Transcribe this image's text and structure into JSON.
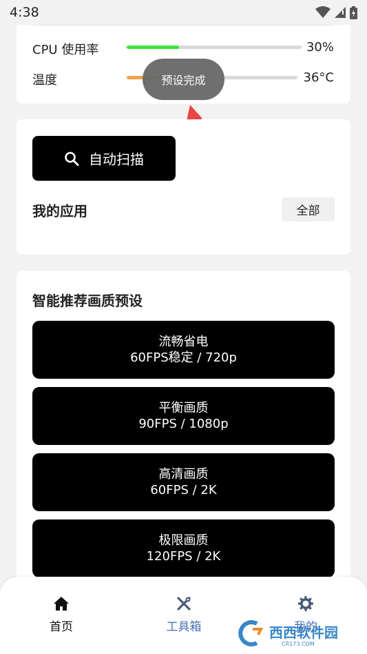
{
  "status": {
    "time": "4:38"
  },
  "stats": {
    "cpu": {
      "label": "CPU 使用率",
      "value": "30%",
      "level": 0.3,
      "color": "#3be33b"
    },
    "temp": {
      "label": "温度",
      "value": "36°C",
      "level": 0.36,
      "color": "#f5a04a"
    }
  },
  "toast": {
    "text": "预设完成"
  },
  "apps": {
    "scan_label": "自动扫描",
    "title": "我的应用",
    "all_label": "全部"
  },
  "presets": {
    "title": "智能推荐画质预设",
    "items": [
      {
        "name": "流畅省电",
        "spec": "60FPS稳定 / 720p"
      },
      {
        "name": "平衡画质",
        "spec": "90FPS / 1080p"
      },
      {
        "name": "高清画质",
        "spec": "60FPS / 2K"
      },
      {
        "name": "极限画质",
        "spec": "120FPS / 2K"
      }
    ]
  },
  "nav": {
    "items": [
      {
        "label": "首页",
        "icon": "home-icon"
      },
      {
        "label": "工具箱",
        "icon": "tools-icon"
      },
      {
        "label": "我的",
        "icon": "gear-icon"
      }
    ]
  },
  "watermark": {
    "text": "西西软件园",
    "sub": "CR173.COM"
  },
  "colors": {
    "accent_blue": "#4a6fb5",
    "black": "#000000",
    "arrow_red": "#e94545"
  }
}
